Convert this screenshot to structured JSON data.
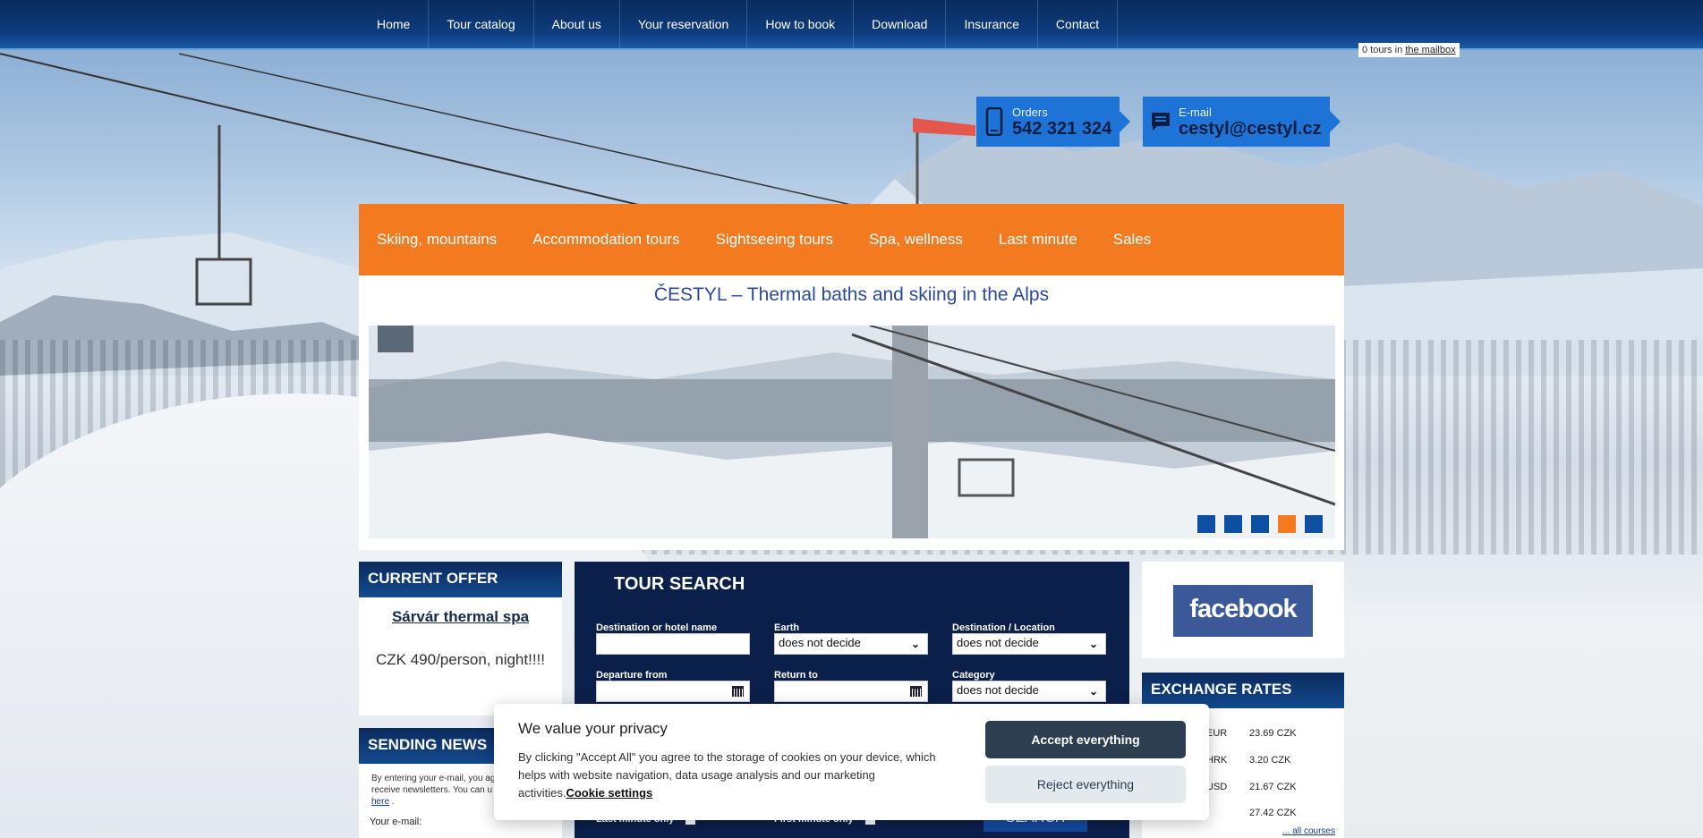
{
  "nav": {
    "items": [
      "Home",
      "Tour catalog",
      "About us",
      "Your reservation",
      "How to book",
      "Download",
      "Insurance",
      "Contact"
    ]
  },
  "mailbox": {
    "prefix": "0 tours in ",
    "link": "the mailbox"
  },
  "contacts": {
    "orders": {
      "label": "Orders",
      "value": "542 321 324"
    },
    "email": {
      "label": "E-mail",
      "value": "cestyl@cestyl.cz"
    }
  },
  "categories": [
    "Skiing, mountains",
    "Accommodation tours",
    "Sightseeing tours",
    "Spa, wellness",
    "Last minute",
    "Sales"
  ],
  "main": {
    "title": "ČESTYL – Thermal baths and skiing in the Alps",
    "active_slide": 4,
    "slide_count": 5
  },
  "offer": {
    "heading": "CURRENT OFFER",
    "name": "Sárvár thermal spa",
    "price": "CZK 490/person, night!!!!"
  },
  "news": {
    "heading": "SENDING NEWS",
    "text_1": "By entering your e-mail, you ag",
    "text_2": "receive newsletters. You can u",
    "link": "here",
    "link_suffix": " .",
    "email_label": "Your e-mail:"
  },
  "search": {
    "heading": "TOUR SEARCH",
    "destination_label": "Destination or hotel name",
    "destination_value": "",
    "earth_label": "Earth",
    "earth_value": "does not decide",
    "location_label": "Destination / Location",
    "location_value": "does not decide",
    "departure_label": "Departure from",
    "return_label": "Return to",
    "category_label": "Category",
    "category_value": "does not decide",
    "last_minute_label": "Last minute only",
    "first_minute_label": "First minute only",
    "button": "SEARCH"
  },
  "facebook": {
    "logo": "facebook"
  },
  "rates": {
    "heading": "EXCHANGE RATES",
    "rows": [
      {
        "cur": "EUR",
        "val": "23.69 CZK"
      },
      {
        "cur": "HRK",
        "val": "3.20 CZK"
      },
      {
        "cur": "USD",
        "val": "21.67 CZK"
      },
      {
        "cur": "",
        "val": "27.42 CZK"
      }
    ],
    "all": "... all courses"
  },
  "cookie": {
    "title": "We value your privacy",
    "text": "By clicking \"Accept All\" you agree to the storage of cookies on your device, which helps with website navigation, data usage analysis and our marketing activities.",
    "settings": "Cookie settings",
    "accept": "Accept everything",
    "reject": "Reject everything"
  }
}
